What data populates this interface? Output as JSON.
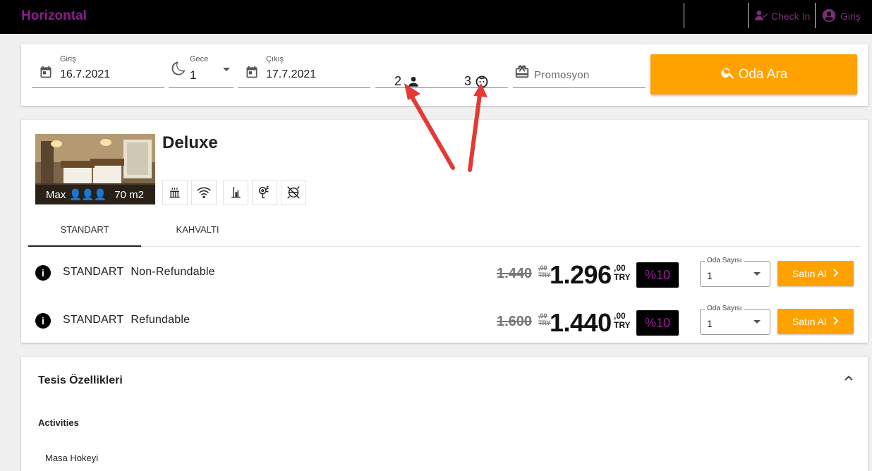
{
  "header": {
    "brand": "Horizontal",
    "check_in_label": "Check In",
    "login_label": "Giriş"
  },
  "search": {
    "checkin": {
      "label": "Giriş",
      "value": "16.7.2021"
    },
    "nights": {
      "label": "Gece",
      "value": "1"
    },
    "checkout": {
      "label": "Çıkış",
      "value": "17.7.2021"
    },
    "adults": "2",
    "children": "3",
    "promo_placeholder": "Promosyon",
    "search_button": "Oda Ara"
  },
  "room": {
    "title": "Deluxe",
    "max_label": "Max",
    "area": "70 m2",
    "amenity_icons": [
      "heater-icon",
      "wifi-icon",
      "minibar-icon",
      "hairdryer-icon",
      "no-smoking-icon"
    ],
    "tabs": [
      "STANDART",
      "KAHVALTI"
    ],
    "rates": [
      {
        "plan": "STANDART",
        "name": "Non-Refundable",
        "old_price": "1.440",
        "old_cents": ",00",
        "old_currency": "TRY",
        "price": "1.296",
        "cents": ",00",
        "currency": "TRY",
        "discount": "%10",
        "room_count_label": "Oda Sayısı",
        "room_count": "1",
        "buy_label": "Satın Al"
      },
      {
        "plan": "STANDART",
        "name": "Refundable",
        "old_price": "1.600",
        "old_cents": ",00",
        "old_currency": "TRY",
        "price": "1.440",
        "cents": ",00",
        "currency": "TRY",
        "discount": "%10",
        "room_count_label": "Oda Sayısı",
        "room_count": "1",
        "buy_label": "Satın Al"
      }
    ]
  },
  "facilities": {
    "title": "Tesis Özellikleri",
    "section": "Activities",
    "items": [
      "Masa Hokeyi"
    ]
  },
  "colors": {
    "brand": "#8e1a8e",
    "accent": "#ffa200",
    "annotation_arrow": "#e53935"
  }
}
